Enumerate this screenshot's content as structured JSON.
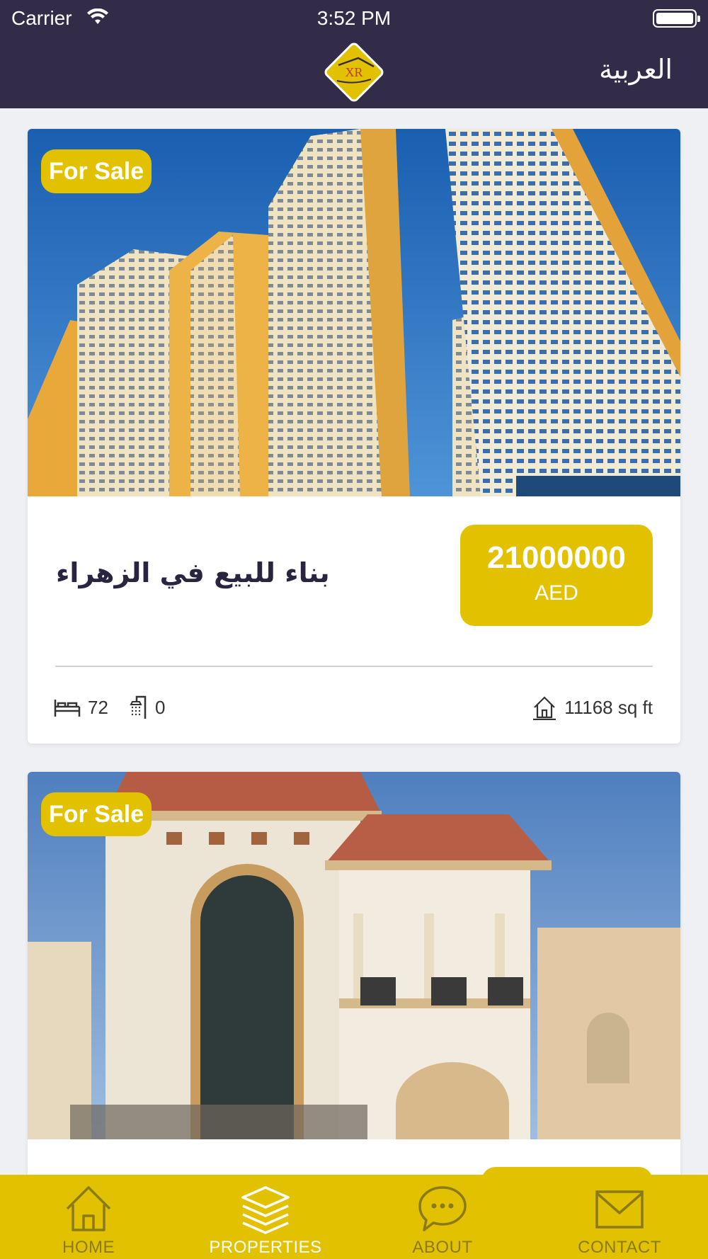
{
  "status_bar": {
    "carrier": "Carrier",
    "time": "3:52 PM"
  },
  "header": {
    "language_label": "العربية",
    "logo_text": "XR"
  },
  "listings": [
    {
      "badge": "For Sale",
      "title": "بناء للبيع في الزهراء",
      "price": "21000000",
      "currency": "AED",
      "bedrooms": "72",
      "bathrooms": "0",
      "area": "11168 sq ft"
    },
    {
      "badge": "For Sale"
    }
  ],
  "tabbar": {
    "tabs": [
      {
        "label": "HOME",
        "icon": "home-icon",
        "active": false
      },
      {
        "label": "PROPERTIES",
        "icon": "layers-icon",
        "active": true
      },
      {
        "label": "ABOUT",
        "icon": "chat-bubble-icon",
        "active": false
      },
      {
        "label": "CONTACT",
        "icon": "envelope-icon",
        "active": false
      }
    ]
  },
  "colors": {
    "header_bg": "#332c48",
    "accent": "#e2c200",
    "page_bg": "#eef0f3"
  }
}
